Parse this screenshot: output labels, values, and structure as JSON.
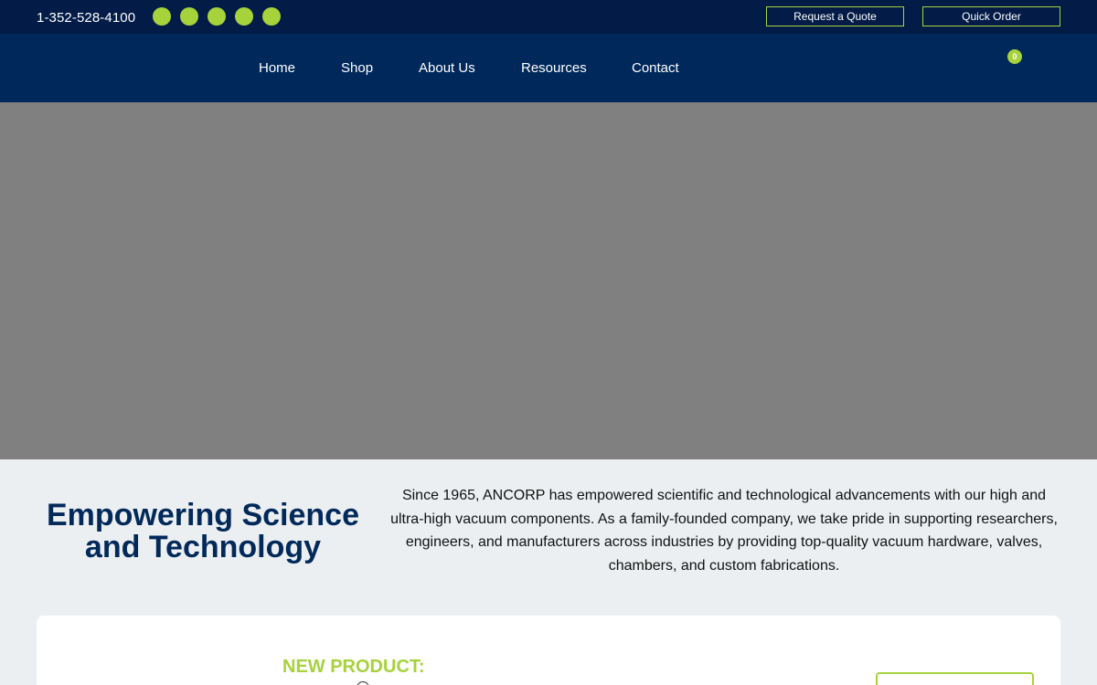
{
  "topbar": {
    "phone": "1-352-528-4100",
    "socials": [
      "social-icon-1",
      "social-icon-2",
      "social-icon-3",
      "social-icon-4",
      "social-icon-5"
    ],
    "request_quote_label": "Request a Quote",
    "quick_order_label": "Quick Order"
  },
  "nav": {
    "items": [
      {
        "label": "Home"
      },
      {
        "label": "Shop"
      },
      {
        "label": "About Us"
      },
      {
        "label": "Resources"
      },
      {
        "label": "Contact"
      }
    ],
    "cart_count": "0"
  },
  "intro": {
    "title": "Empowering Science and Technology",
    "text": "Since 1965, ANCORP has empowered scientific and technological advancements with our high and ultra-high vacuum components. As a family-founded company, we take pride in supporting researchers, engineers, and manufacturers across industries by providing top-quality vacuum hardware, valves, chambers, and custom fabrications."
  },
  "feature": {
    "label": "NEW PRODUCT:"
  },
  "colors": {
    "topbar_bg": "#021b47",
    "nav_bg": "#00285a",
    "accent": "#a6d23c",
    "hero_placeholder": "#808080",
    "page_bg": "#ebeff1"
  }
}
